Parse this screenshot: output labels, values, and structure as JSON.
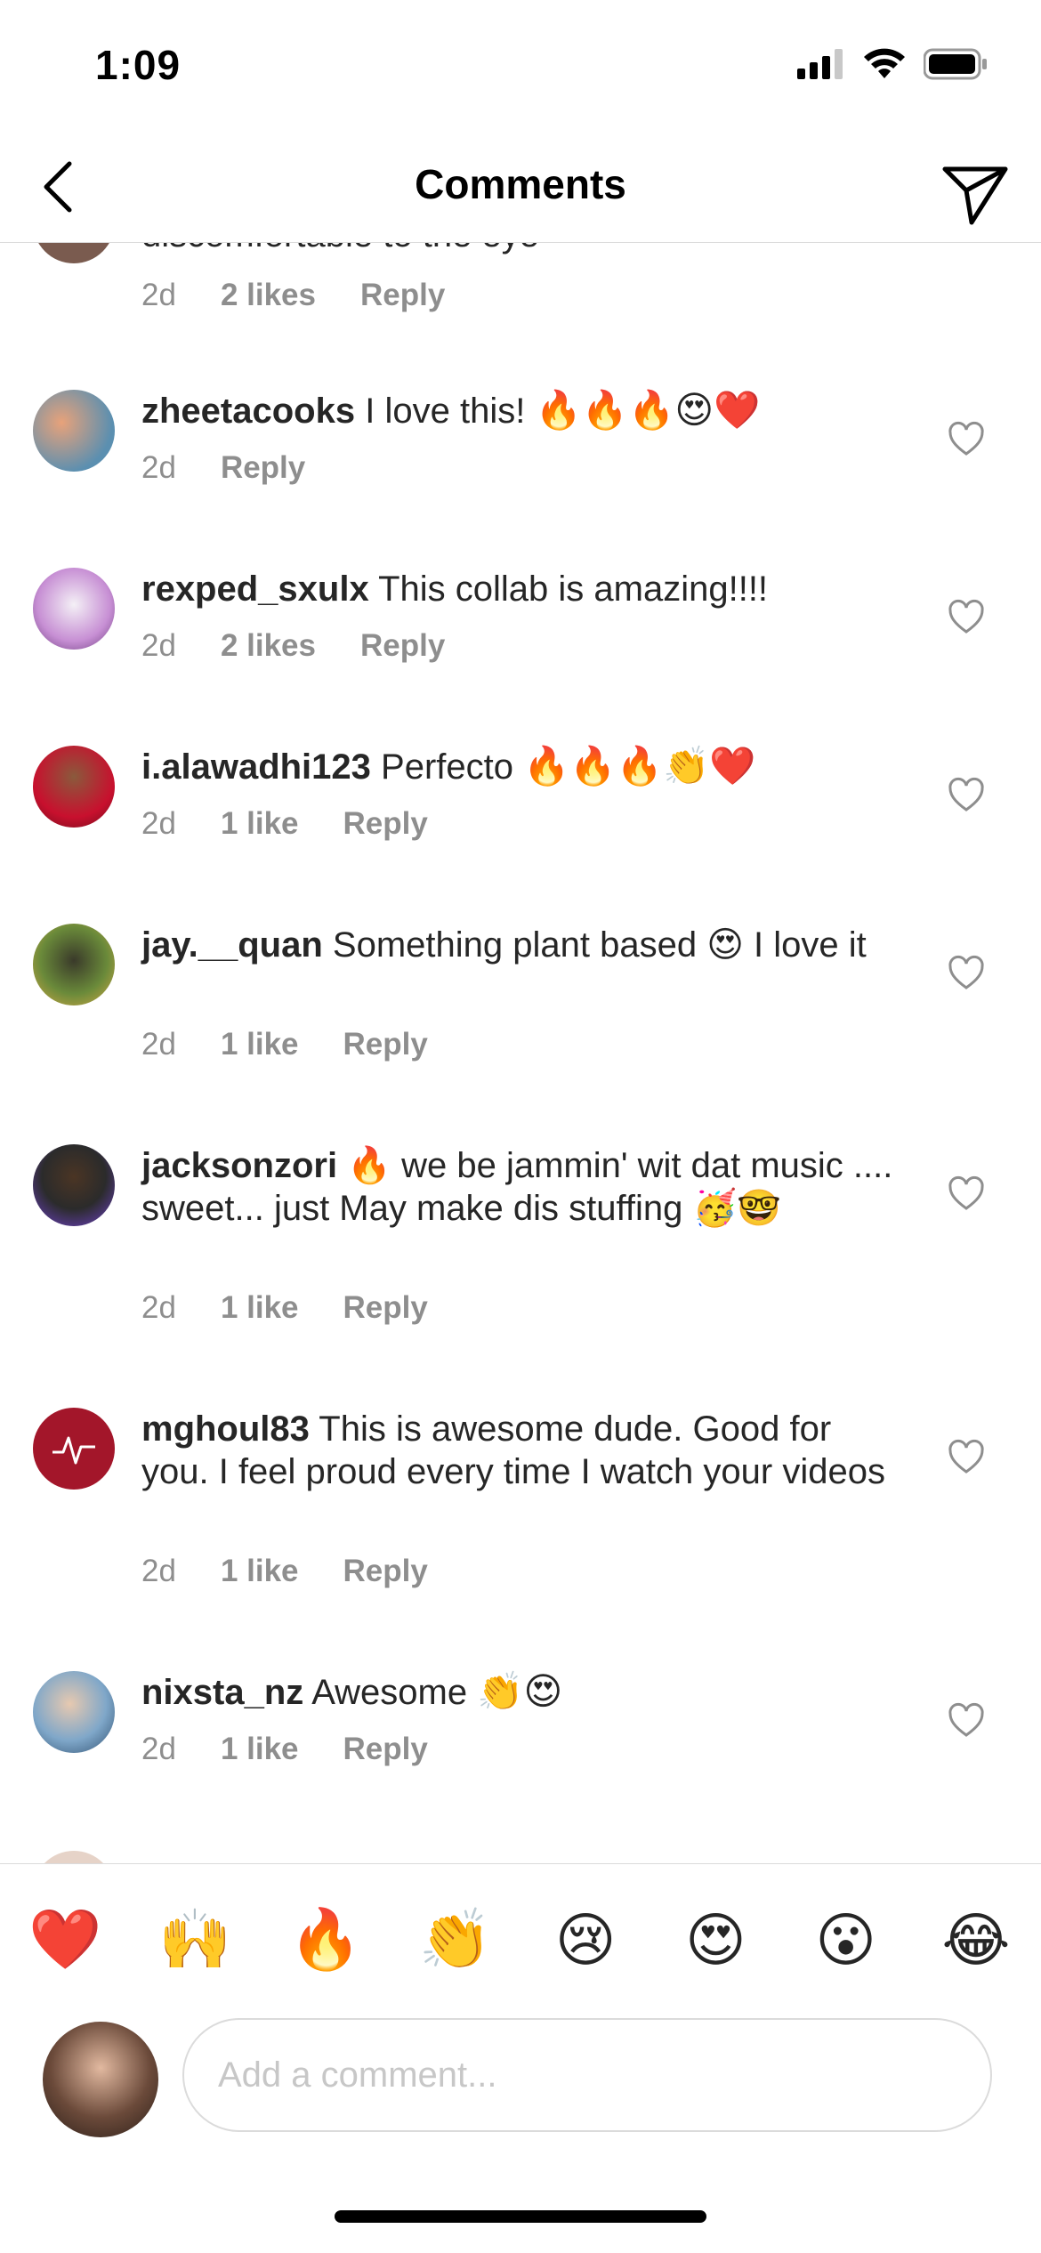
{
  "status": {
    "time": "1:09"
  },
  "header": {
    "title": "Comments"
  },
  "partial_top": {
    "text": "discomfortable to the eye",
    "time": "2d",
    "likes": "2 likes",
    "reply": "Reply"
  },
  "comments": [
    {
      "username": "zheetacooks",
      "text": "I love this!",
      "emoji": "🔥🔥🔥😍❤️",
      "time": "2d",
      "likes": "",
      "reply": "Reply"
    },
    {
      "username": "rexped_sxulx",
      "text": "This collab is amazing!!!!",
      "emoji": "",
      "time": "2d",
      "likes": "2 likes",
      "reply": "Reply"
    },
    {
      "username": "i.alawadhi123",
      "text": "Perfecto",
      "emoji": "🔥🔥🔥👏❤️",
      "time": "2d",
      "likes": "1 like",
      "reply": "Reply"
    },
    {
      "username": "jay.__quan",
      "text": "Something plant based 😍 I love it",
      "emoji": "",
      "time": "2d",
      "likes": "1 like",
      "reply": "Reply"
    },
    {
      "username": "jacksonzori",
      "text": "🔥 we be jammin' wit dat music .... sweet... just May make dis stuffing 🥳🤓",
      "emoji": "",
      "time": "2d",
      "likes": "1 like",
      "reply": "Reply"
    },
    {
      "username": "mghoul83",
      "text": "This is awesome dude. Good for you. I feel proud every time I watch your videos",
      "emoji": "",
      "time": "2d",
      "likes": "1 like",
      "reply": "Reply"
    },
    {
      "username": "nixsta_nz",
      "text": "Awesome",
      "emoji": "👏😍",
      "time": "2d",
      "likes": "1 like",
      "reply": "Reply"
    }
  ],
  "emoji_bar": [
    "❤️",
    "🙌",
    "🔥",
    "👏",
    "😢",
    "😍",
    "😮",
    "😂"
  ],
  "composer": {
    "placeholder": "Add a comment..."
  },
  "colors": {
    "text": "#262626",
    "meta": "#8e8e8e",
    "divider": "#dbdbdb"
  }
}
